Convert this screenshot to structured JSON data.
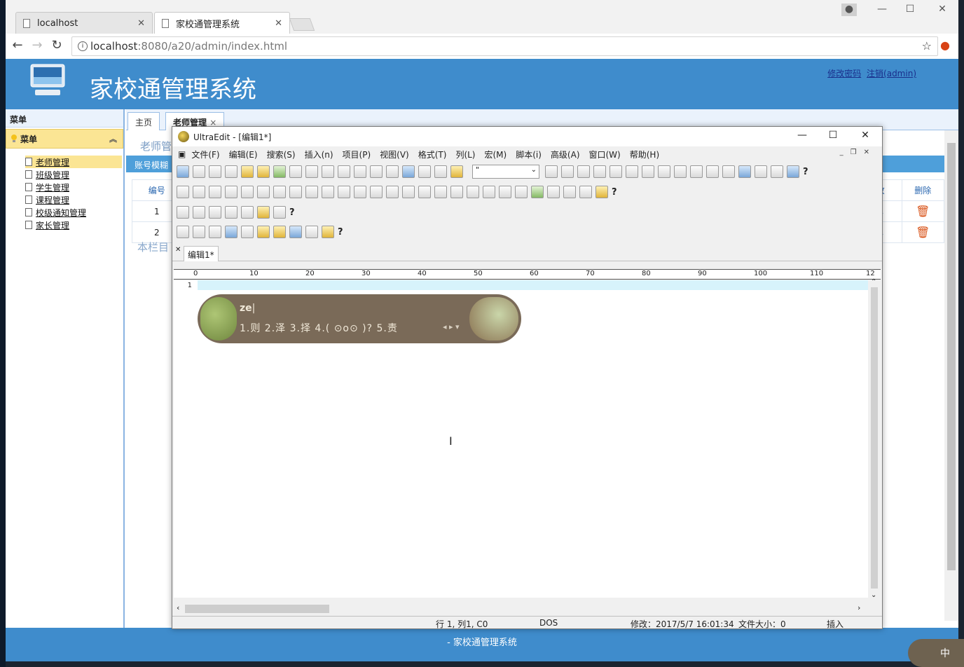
{
  "browser": {
    "tabs": [
      {
        "label": "localhost",
        "active": false
      },
      {
        "label": "家校通管理系统",
        "active": true
      }
    ],
    "address": {
      "host": "localhost",
      "rest": ":8080/a20/admin/index.html"
    }
  },
  "site": {
    "title": "家校通管理系统",
    "links": {
      "change_password": "修改密码",
      "logout": "注销(admin)"
    },
    "sidebar": {
      "header": "菜单",
      "group": "菜单",
      "items": [
        {
          "label": "老师管理"
        },
        {
          "label": "班级管理"
        },
        {
          "label": "学生管理"
        },
        {
          "label": "课程管理"
        },
        {
          "label": "校级通知管理"
        },
        {
          "label": "家长管理"
        }
      ]
    },
    "tabs": {
      "home": "主页",
      "teacher": "老师管理"
    },
    "content_title": "老师管",
    "search_label": "账号模糊",
    "table": {
      "col_no": "编号",
      "col_edit": "改",
      "col_delete": "删除",
      "rows": [
        {
          "no": "1"
        },
        {
          "no": "2"
        }
      ]
    },
    "note": "本栏目",
    "footer": "- 家校通管理系统"
  },
  "ultraedit": {
    "title": "UltraEdit - [编辑1*]",
    "menu": [
      "文件(F)",
      "编辑(E)",
      "搜索(S)",
      "插入(n)",
      "项目(P)",
      "视图(V)",
      "格式(T)",
      "列(L)",
      "宏(M)",
      "脚本(i)",
      "高级(A)",
      "窗口(W)",
      "帮助(H)"
    ],
    "font_select": "\"",
    "doc_tab": "编辑1*",
    "line_no": "1",
    "ruler": [
      "0",
      "10",
      "20",
      "30",
      "40",
      "50",
      "60",
      "70",
      "80",
      "90",
      "100",
      "110",
      "12"
    ],
    "ime": {
      "composition": "ze",
      "candidates": "1.则  2.泽  3.择  4.( ⊙o⊙ )?  5.责"
    },
    "status": {
      "position": "行 1, 列1, C0",
      "encoding": "DOS",
      "modified": "修改：2017/5/7 16:01:34",
      "filesize": "文件大小：0",
      "mode": "插入"
    }
  },
  "tray": {
    "ime_label": "中"
  },
  "colors": {
    "banner": "#3f8ccc",
    "sidebar_highlight": "#fbe594",
    "current_line": "#d7f3fb"
  }
}
